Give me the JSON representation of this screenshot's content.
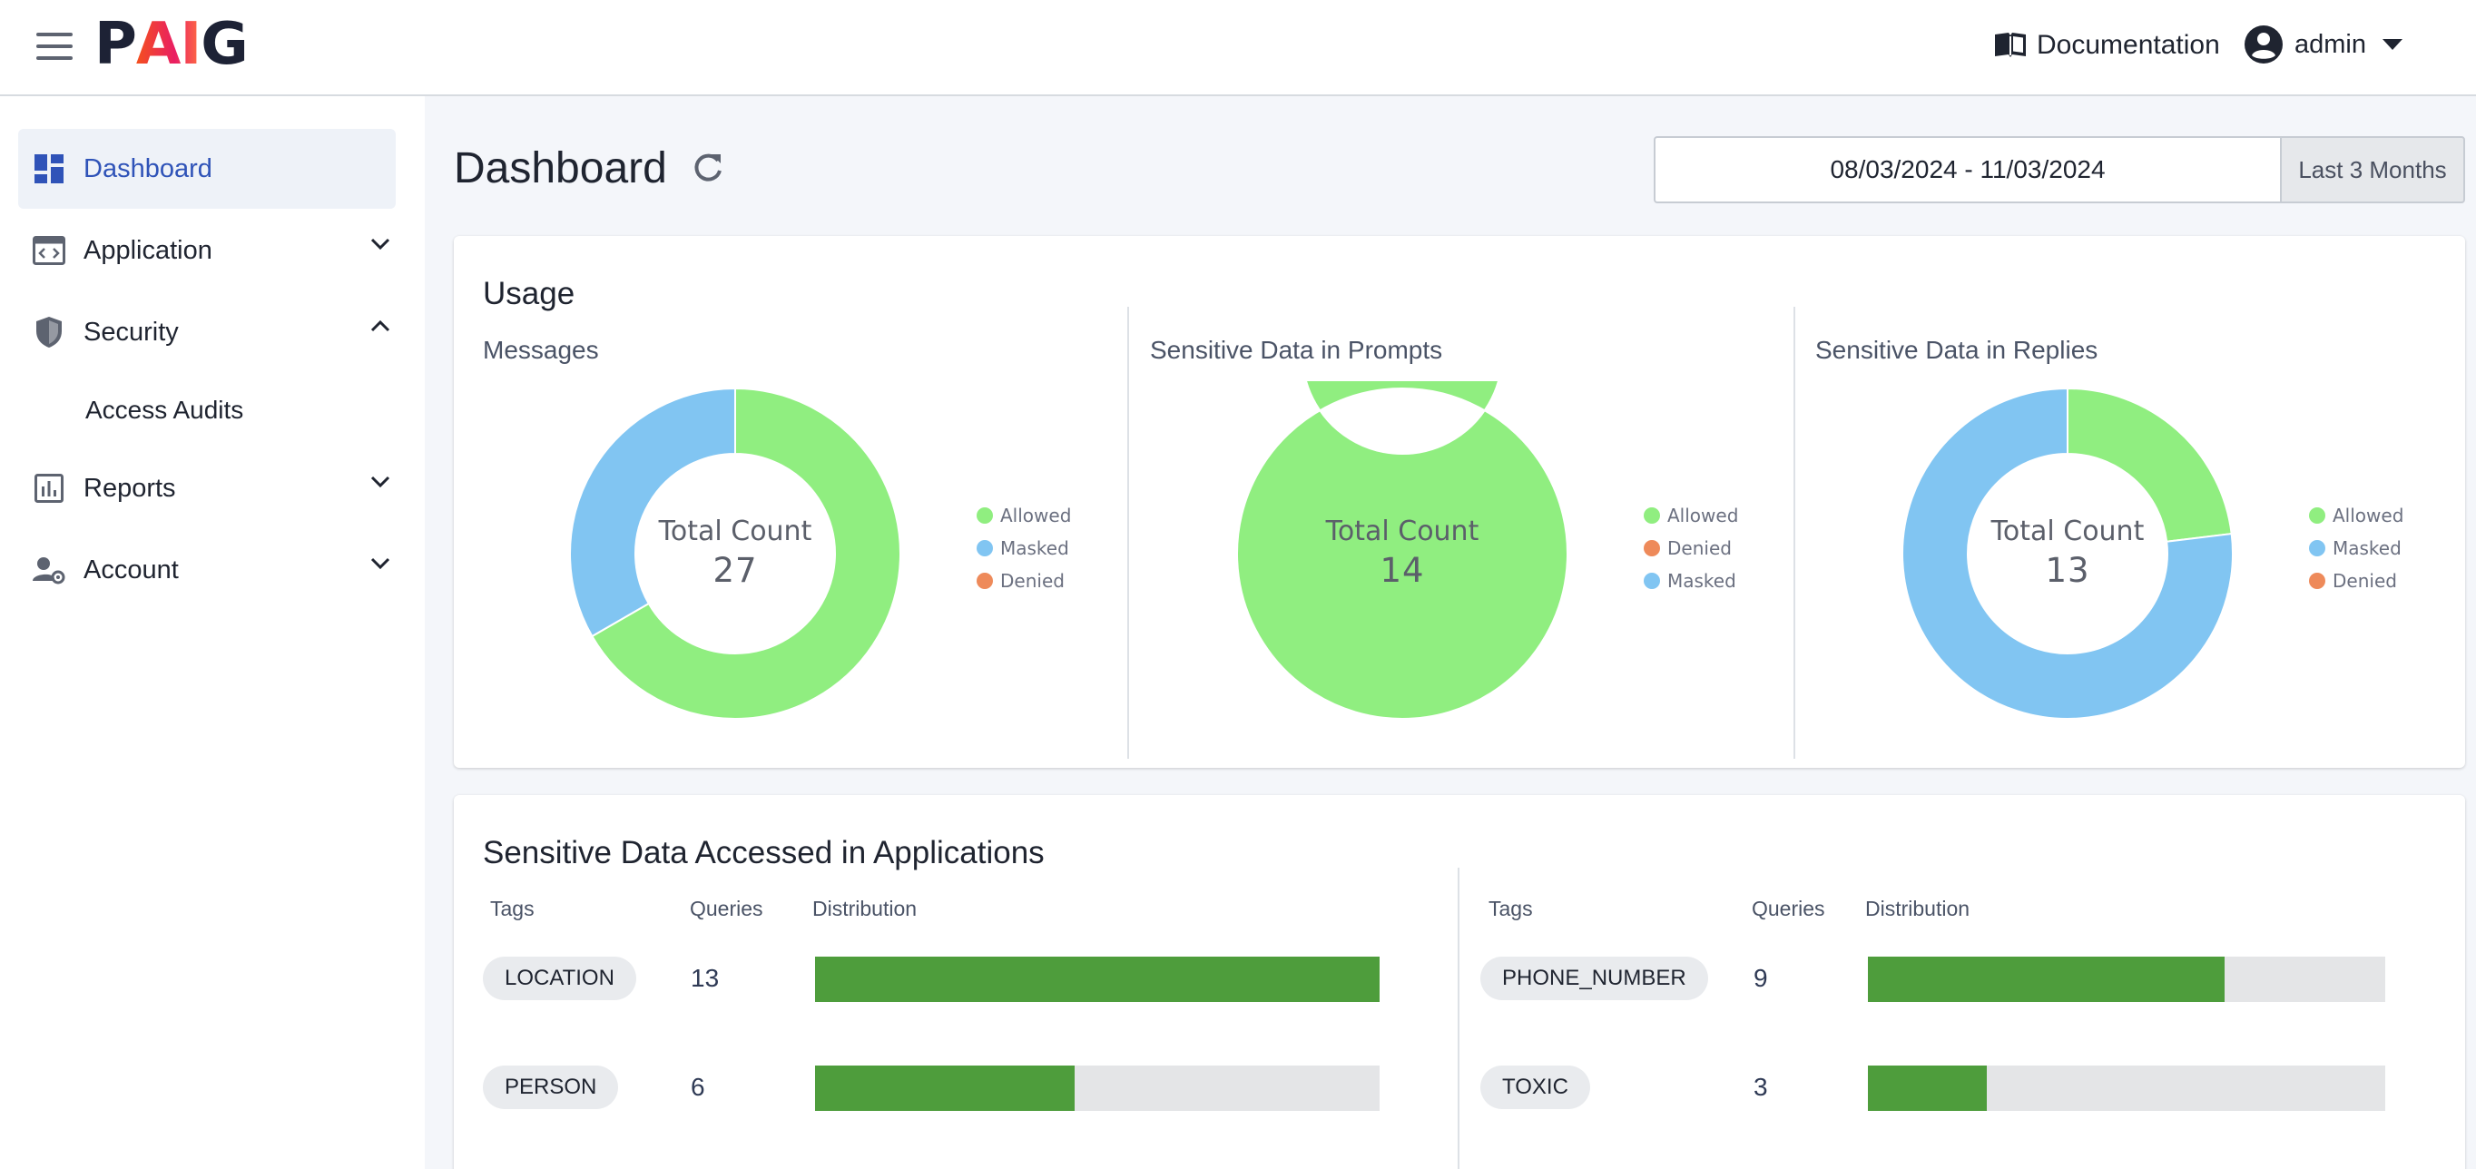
{
  "app": {
    "logo_prefix": "P",
    "logo_ai": "AI",
    "logo_suffix": "G",
    "documentation_label": "Documentation",
    "user_name": "admin"
  },
  "sidebar": {
    "items": [
      {
        "label": "Dashboard",
        "icon": "dashboard-icon",
        "active": true
      },
      {
        "label": "Application",
        "icon": "application-icon",
        "expanded": false
      },
      {
        "label": "Security",
        "icon": "shield-icon",
        "expanded": true
      },
      {
        "label": "Reports",
        "icon": "bar-chart-icon",
        "expanded": false
      },
      {
        "label": "Account",
        "icon": "user-gear-icon",
        "expanded": false
      }
    ],
    "security_sub": [
      "Access Audits"
    ]
  },
  "header": {
    "title": "Dashboard",
    "date_range": "08/03/2024 - 11/03/2024",
    "date_preset": "Last 3 Months"
  },
  "usage": {
    "title": "Usage",
    "total_label": "Total Count"
  },
  "chart_data": [
    {
      "type": "pie",
      "title": "Messages",
      "total": "27",
      "legend": [
        "Allowed",
        "Masked",
        "Denied"
      ],
      "slices": [
        {
          "name": "Allowed",
          "value": 18,
          "color": "#90ee80"
        },
        {
          "name": "Masked",
          "value": 9,
          "color": "#81c5f2"
        },
        {
          "name": "Denied",
          "value": 0,
          "color": "#ee8a5a"
        }
      ]
    },
    {
      "type": "pie",
      "title": "Sensitive Data in Prompts",
      "total": "14",
      "legend": [
        "Allowed",
        "Denied",
        "Masked"
      ],
      "slices": [
        {
          "name": "Allowed",
          "value": 14,
          "color": "#90ee80"
        },
        {
          "name": "Denied",
          "value": 0,
          "color": "#ee8a5a"
        },
        {
          "name": "Masked",
          "value": 0,
          "color": "#81c5f2"
        }
      ]
    },
    {
      "type": "pie",
      "title": "Sensitive Data in Replies",
      "total": "13",
      "legend": [
        "Allowed",
        "Masked",
        "Denied"
      ],
      "slices": [
        {
          "name": "Allowed",
          "value": 3,
          "color": "#90ee80"
        },
        {
          "name": "Masked",
          "value": 10,
          "color": "#81c5f2"
        },
        {
          "name": "Denied",
          "value": 0,
          "color": "#ee8a5a"
        }
      ]
    }
  ],
  "sensitive": {
    "title": "Sensitive Data Accessed in Applications",
    "headers": {
      "tags": "Tags",
      "queries": "Queries",
      "distribution": "Distribution"
    },
    "left": [
      {
        "tag": "LOCATION",
        "queries": "13",
        "distribution": 1.0
      },
      {
        "tag": "PERSON",
        "queries": "6",
        "distribution": 0.46
      }
    ],
    "right": [
      {
        "tag": "PHONE_NUMBER",
        "queries": "9",
        "distribution": 0.69
      },
      {
        "tag": "TOXIC",
        "queries": "3",
        "distribution": 0.23
      }
    ]
  },
  "colors": {
    "accent": "#2f53b8",
    "allowed": "#90ee80",
    "masked": "#81c5f2",
    "denied": "#ee8a5a",
    "bar": "#4e9d3c"
  }
}
